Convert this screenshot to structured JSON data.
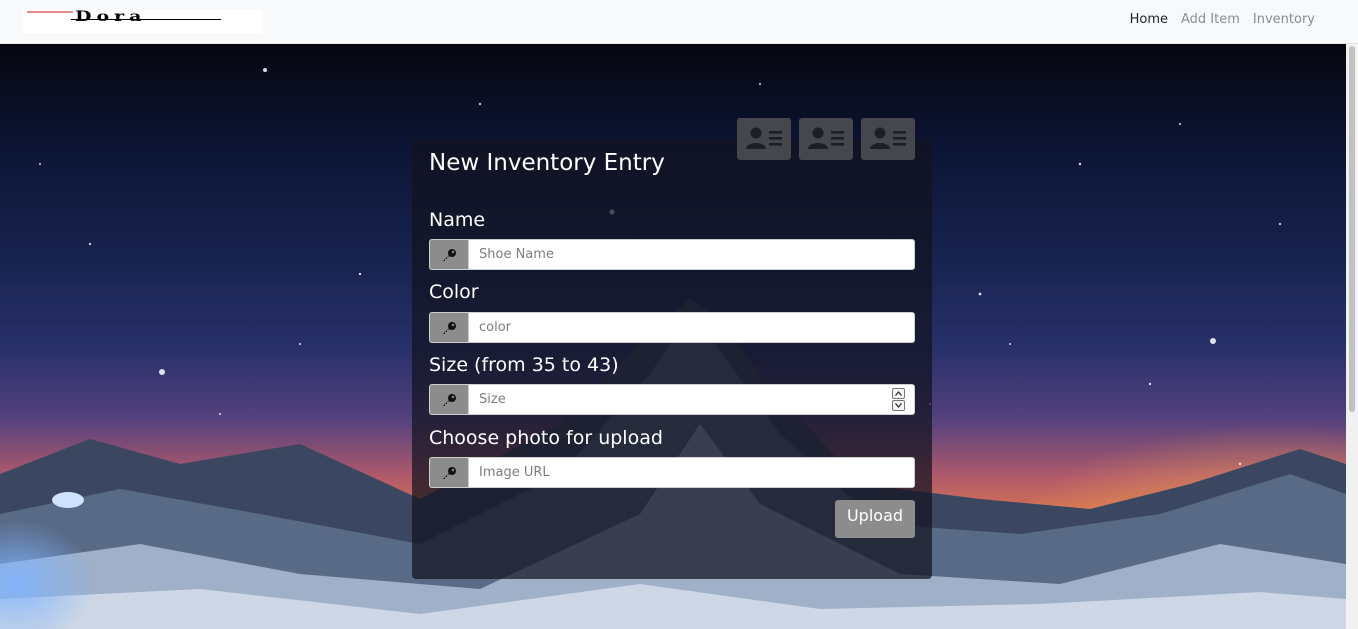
{
  "navbar": {
    "logo_text": "Dora",
    "links": [
      {
        "label": "Home",
        "active": true
      },
      {
        "label": "Add Item",
        "active": false
      },
      {
        "label": "Inventory",
        "active": false
      }
    ]
  },
  "form": {
    "title": "New Inventory Entry",
    "fields": [
      {
        "label": "Name",
        "placeholder": "Shoe Name",
        "value": "",
        "icon": "key-icon"
      },
      {
        "label": "Color",
        "placeholder": "color",
        "value": "",
        "icon": "key-icon"
      },
      {
        "label": "Size (from 35 to 43)",
        "placeholder": "Size",
        "value": "",
        "icon": "key-icon",
        "type": "number"
      },
      {
        "label": "Choose photo for upload",
        "placeholder": "Image URL",
        "value": "",
        "icon": "key-icon"
      }
    ],
    "submit_label": "Upload"
  },
  "card_buttons": [
    "contact-card-icon",
    "contact-card-icon",
    "contact-card-icon"
  ],
  "colors": {
    "navbar_bg": "#f8f9fa",
    "panel_bg": "rgba(18,20,32,0.72)",
    "addon_bg": "#8c8c8c",
    "button_bg": "#8c8c8c",
    "card_btn_bg": "#45474d"
  }
}
